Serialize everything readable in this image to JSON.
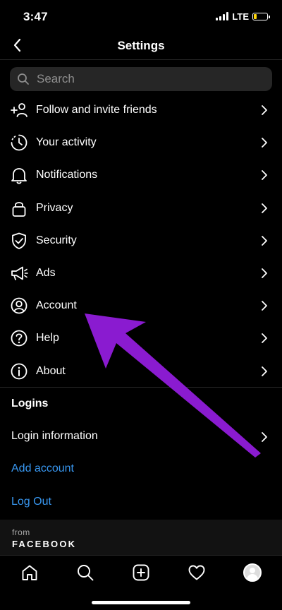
{
  "status_bar": {
    "time": "3:47",
    "network": "LTE"
  },
  "nav": {
    "title": "Settings"
  },
  "search": {
    "placeholder": "Search"
  },
  "menu": {
    "items": [
      {
        "label": "Follow and invite friends",
        "icon": "add-person-icon"
      },
      {
        "label": "Your activity",
        "icon": "activity-clock-icon"
      },
      {
        "label": "Notifications",
        "icon": "bell-icon"
      },
      {
        "label": "Privacy",
        "icon": "lock-icon"
      },
      {
        "label": "Security",
        "icon": "shield-icon"
      },
      {
        "label": "Ads",
        "icon": "megaphone-icon"
      },
      {
        "label": "Account",
        "icon": "user-circle-icon"
      },
      {
        "label": "Help",
        "icon": "help-icon"
      },
      {
        "label": "About",
        "icon": "info-icon"
      }
    ]
  },
  "logins": {
    "title": "Logins",
    "login_information": "Login information",
    "add_account": "Add account",
    "log_out": "Log Out"
  },
  "footer": {
    "from": "from",
    "brand": "FACEBOOK"
  },
  "tabs": [
    "home-icon",
    "search-icon",
    "new-post-icon",
    "heart-icon",
    "profile-avatar"
  ],
  "colors": {
    "link": "#3897f0",
    "annotation_arrow": "#8a1bd0",
    "background": "#000000"
  }
}
